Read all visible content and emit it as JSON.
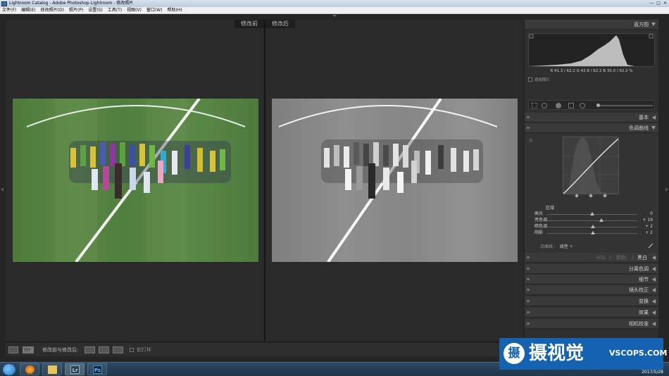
{
  "window": {
    "title": "Lightroom Catalog - Adobe Photoshop Lightroom - 修改照片",
    "controls": [
      "—",
      "□",
      "✕"
    ]
  },
  "menu": [
    "文件(F)",
    "编辑(E)",
    "修改照片(D)",
    "照片(P)",
    "设置(S)",
    "工具(T)",
    "视图(V)",
    "窗口(W)",
    "帮助(H)"
  ],
  "viewer": {
    "before_label": "修改前",
    "after_label": "修改后"
  },
  "panel": {
    "histogram_title": "直方图",
    "histogram_readout": "R 41.3 / 62.2   G 42.8 / 62.2   B 35.0 / 62.2 %",
    "original_photo_label": "原始照片",
    "basic_title": "基本",
    "tone_curve_title": "色调曲线",
    "region_label": "区域",
    "sliders": [
      {
        "label": "高光",
        "value": "0",
        "position": 0.5
      },
      {
        "label": "亮色调",
        "value": "+ 19",
        "position": 0.6
      },
      {
        "label": "暗色调",
        "value": "+ 2",
        "position": 0.51
      },
      {
        "label": "阴影",
        "value": "+ 2",
        "position": 0.51
      }
    ],
    "point_curve_label": "点曲线 :",
    "point_curve_value": "线性 ÷",
    "tabs": {
      "hsl": "HSL",
      "sep1": "/",
      "color": "颜色",
      "sep2": "/",
      "bw": "黑白"
    },
    "sections": [
      "分离色调",
      "细节",
      "镜头校正",
      "变换",
      "效果",
      "相机校准"
    ]
  },
  "toolbar": {
    "compare_label": "修改前与修改后:",
    "yy_label": "Y|Y",
    "soft_proof_label": "软打样"
  },
  "taskbar": {
    "apps": [
      "Lr",
      "Ps"
    ],
    "date": "2017/5/28"
  },
  "watermark": {
    "logo_char": "摄",
    "cn_text": "摄视觉",
    "en_text": "VSCOPS.COM"
  },
  "colors": {
    "field_green": "#5a8746",
    "panel_bg": "#2f2f2f",
    "watermark_blue": "#1562b0"
  }
}
